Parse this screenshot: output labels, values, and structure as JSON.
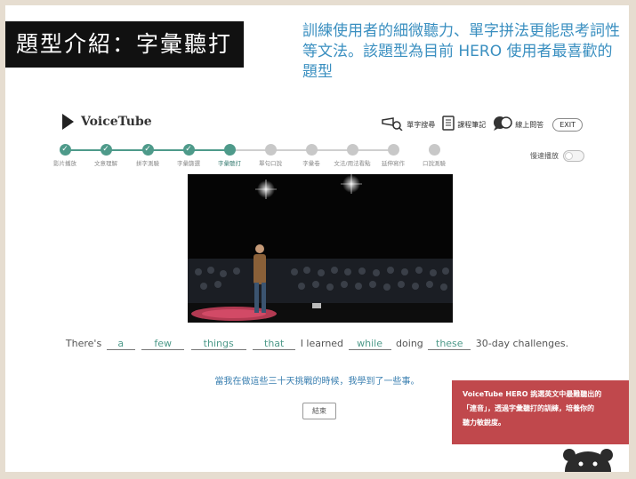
{
  "slide": {
    "title": "題型介紹：字彙聽打",
    "description": "訓練使用者的細微聽力、單字拼法更能思考詞性等文法。該題型為目前 HERO 使用者最喜歡的題型"
  },
  "app": {
    "logo_text": "VoiceTube",
    "tools": [
      {
        "icon": "word-search-icon",
        "label": "單字搜尋"
      },
      {
        "icon": "notes-icon",
        "label": "課程筆記"
      },
      {
        "icon": "chat-icon",
        "label": "線上問答"
      }
    ],
    "exit_label": "EXIT",
    "autoplay_label": "慢速播放"
  },
  "progress": {
    "steps": [
      {
        "label": "影片播放",
        "state": "done"
      },
      {
        "label": "文意理解",
        "state": "done"
      },
      {
        "label": "拼字測驗",
        "state": "done"
      },
      {
        "label": "字彙篩選",
        "state": "done"
      },
      {
        "label": "字彙聽打",
        "state": "current"
      },
      {
        "label": "單句口說",
        "state": "todo"
      },
      {
        "label": "字彙卷",
        "state": "todo"
      },
      {
        "label": "文法/用法看點",
        "state": "todo"
      },
      {
        "label": "延伸寫作",
        "state": "todo"
      },
      {
        "label": "口說測驗",
        "state": "todo"
      }
    ],
    "check_glyph": "✓"
  },
  "exercise": {
    "sentence": [
      {
        "t": "text",
        "v": "There's"
      },
      {
        "t": "blank",
        "v": "a"
      },
      {
        "t": "blank",
        "v": "few"
      },
      {
        "t": "blank",
        "v": "things"
      },
      {
        "t": "blank",
        "v": "that"
      },
      {
        "t": "text",
        "v": "I learned"
      },
      {
        "t": "blank",
        "v": "while"
      },
      {
        "t": "text",
        "v": "doing"
      },
      {
        "t": "blank",
        "v": "these"
      },
      {
        "t": "text",
        "v": "30-day challenges."
      }
    ],
    "translation": "當我在做這些三十天挑戰的時候，我學到了一些事。",
    "end_label": "結束"
  },
  "note": {
    "lines": [
      "VoiceTube HERO 挑選英文中最難聽出的",
      "「連音」，透過字彙聽打的訓練，培養你的",
      "聽力敏銳度。"
    ]
  },
  "colors": {
    "accent": "#4e9a8a",
    "note_bg": "#c0484c",
    "description_text": "#3a8fc0",
    "frame": "#e6ddd0"
  }
}
